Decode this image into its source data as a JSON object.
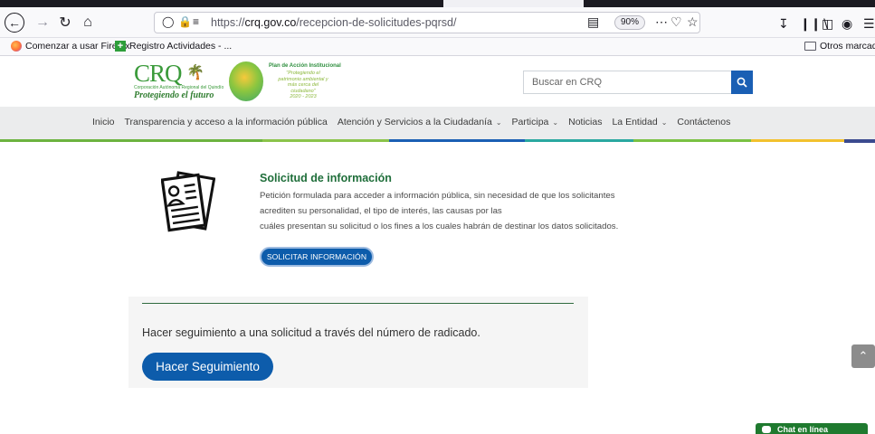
{
  "browser": {
    "url_scheme": "https://",
    "url_domain": "crq.gov.co",
    "url_path": "/recepcion-de-solicitudes-pqrsd/",
    "zoom": "90%",
    "bookmarks": [
      "Comenzar a usar Firefox",
      "Registro Actividades - ...",
      "Otros marcadores"
    ]
  },
  "header": {
    "logo_text": "CRQ",
    "logo_small": "Corporación Autónoma Regional del Quindío",
    "logo_slogan": "Protegiendo el futuro",
    "plan_title": "Plan de Acción Institucional",
    "plan_subtitle": "\"Protegiendo el patrimonio ambiental y más cerca del ciudadano\"",
    "plan_years": "2020 - 2023",
    "search_placeholder": "Buscar en CRQ"
  },
  "menu": {
    "items": [
      {
        "label": "Inicio",
        "dropdown": false
      },
      {
        "label": "Transparencia y acceso a la información pública",
        "dropdown": false
      },
      {
        "label": "Atención y Servicios a la Ciudadanía",
        "dropdown": true
      },
      {
        "label": "Participa",
        "dropdown": true
      },
      {
        "label": "Noticias",
        "dropdown": false
      },
      {
        "label": "La Entidad",
        "dropdown": true
      },
      {
        "label": "Contáctenos",
        "dropdown": false
      }
    ],
    "stripe_colors": [
      "#6cb33f",
      "#8bc34a",
      "#1a5fb4",
      "#2aa8a0",
      "#7ac143",
      "#f2c12e"
    ]
  },
  "solicitud": {
    "title": "Solicitud de información",
    "description_lines": [
      "Petición formulada para acceder a información pública, sin necesidad de que los solicitantes",
      "acrediten su personalidad, el tipo de interés, las causas por las",
      "cuáles presentan su solicitud o los fines a los cuales habrán de destinar los datos solicitados."
    ],
    "button_label": "SOLICITAR INFORMACIÓN"
  },
  "seguimiento": {
    "text": "Hacer seguimiento a una solicitud a través del número de radicado.",
    "button_label": "Hacer Seguimiento"
  },
  "chat": {
    "label": "Chat en línea"
  },
  "colors": {
    "primary_blue": "#0d5cab",
    "title_green": "#1f6e3a",
    "chat_green": "#1f7a2f"
  }
}
